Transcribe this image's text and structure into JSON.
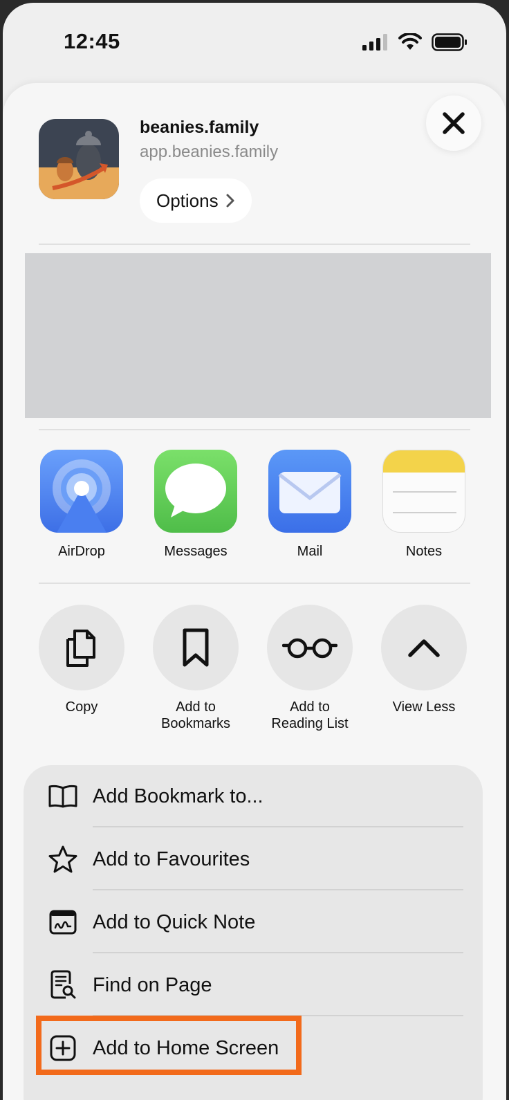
{
  "status_bar": {
    "time": "12:45",
    "icons": [
      "signal-icon",
      "wifi-icon",
      "battery-icon"
    ]
  },
  "header": {
    "site_name": "beanies.family",
    "site_url": "app.beanies.family",
    "options_label": "Options",
    "close_icon": "close-icon"
  },
  "share_apps": [
    {
      "label": "AirDrop",
      "icon": "airdrop-icon"
    },
    {
      "label": "Messages",
      "icon": "messages-icon"
    },
    {
      "label": "Mail",
      "icon": "mail-icon"
    },
    {
      "label": "Notes",
      "icon": "notes-icon"
    }
  ],
  "actions": [
    {
      "label_line1": "Copy",
      "label_line2": "",
      "icon": "copy-icon"
    },
    {
      "label_line1": "Add to",
      "label_line2": "Bookmarks",
      "icon": "bookmark-icon"
    },
    {
      "label_line1": "Add to",
      "label_line2": "Reading List",
      "icon": "glasses-icon"
    },
    {
      "label_line1": "View Less",
      "label_line2": "",
      "icon": "chevron-up-icon"
    }
  ],
  "menu": [
    {
      "label": "Add Bookmark to...",
      "icon": "book-icon"
    },
    {
      "label": "Add to Favourites",
      "icon": "star-icon"
    },
    {
      "label": "Add to Quick Note",
      "icon": "quick-note-icon"
    },
    {
      "label": "Find on Page",
      "icon": "find-on-page-icon"
    },
    {
      "label": "Add to Home Screen",
      "icon": "plus-square-icon"
    }
  ],
  "colors": {
    "highlight": "#f26a1b",
    "airdrop": "#4a7ff0",
    "messages": "#5fcf5b",
    "mail": "#4a86f2",
    "notes_top": "#f3d34a"
  }
}
